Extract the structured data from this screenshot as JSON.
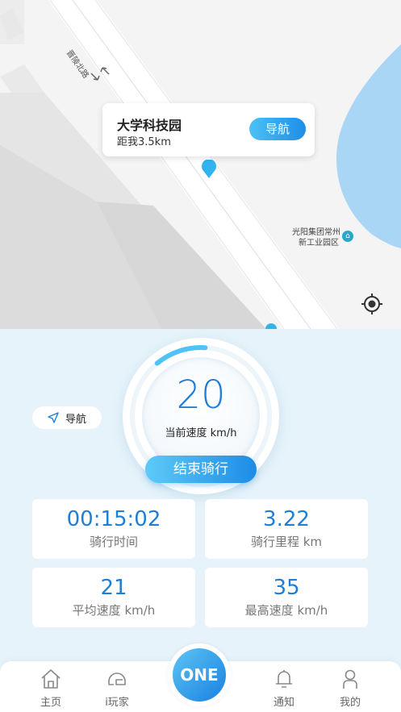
{
  "map": {
    "street_name": "晋陵北路",
    "poi_line1": "光阳集团常州",
    "poi_line2": "新工业园区",
    "poi_icon": "building-icon",
    "locate_icon": "locate-target-icon"
  },
  "destination": {
    "name": "大学科技园",
    "distance": "距我3.5km",
    "nav_label": "导航"
  },
  "ride": {
    "speed": "20",
    "speed_label": "当前速度 km/h",
    "end_label": "结束骑行",
    "nav_label": "导航",
    "speed_arc_fraction": 0.12
  },
  "stats": [
    {
      "value": "00:15:02",
      "label": "骑行时间"
    },
    {
      "value": "3.22",
      "label": "骑行里程 km"
    },
    {
      "value": "21",
      "label": "平均速度 km/h"
    },
    {
      "value": "35",
      "label": "最高速度 km/h"
    }
  ],
  "tabbar": {
    "home": "主页",
    "play": "i玩家",
    "center": "ONE",
    "notify": "通知",
    "mine": "我的"
  },
  "colors": {
    "accent": "#1f7fd6",
    "accent_light": "#4cc2f5",
    "panel_bg": "#e6f3fa",
    "water": "#a9d6f5"
  }
}
